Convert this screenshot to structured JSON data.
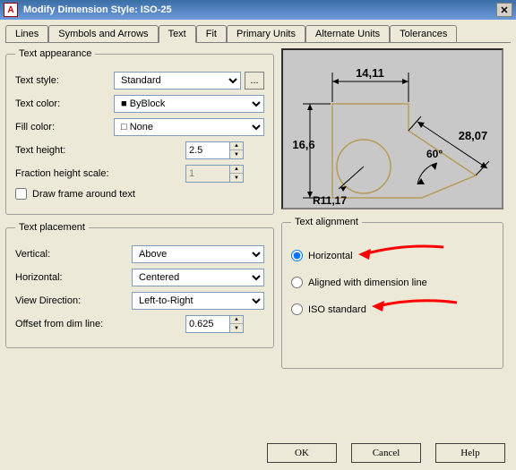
{
  "window": {
    "title": "Modify Dimension Style: ISO-25",
    "app_icon_letter": "A"
  },
  "tabs": [
    "Lines",
    "Symbols and Arrows",
    "Text",
    "Fit",
    "Primary Units",
    "Alternate Units",
    "Tolerances"
  ],
  "active_tab": "Text",
  "text_appearance": {
    "legend": "Text appearance",
    "style_label": "Text style:",
    "style_value": "Standard",
    "color_label": "Text color:",
    "color_value": "ByBlock",
    "fill_label": "Fill color:",
    "fill_value": "None",
    "height_label": "Text height:",
    "height_value": "2.5",
    "fraction_label": "Fraction height scale:",
    "fraction_value": "1",
    "frame_label": "Draw frame around text",
    "frame_checked": false
  },
  "text_placement": {
    "legend": "Text placement",
    "vertical_label": "Vertical:",
    "vertical_value": "Above",
    "horizontal_label": "Horizontal:",
    "horizontal_value": "Centered",
    "viewdir_label": "View Direction:",
    "viewdir_value": "Left-to-Right",
    "offset_label": "Offset from dim line:",
    "offset_value": "0.625"
  },
  "text_alignment": {
    "legend": "Text alignment",
    "horizontal_label": "Horizontal",
    "aligned_label": "Aligned with dimension line",
    "iso_label": "ISO standard",
    "selected": "horizontal"
  },
  "preview": {
    "dim_top": "14,11",
    "dim_left": "16,6",
    "dim_right": "28,07",
    "dim_radius": "R11,17",
    "dim_angle": "60°"
  },
  "buttons": {
    "ok": "OK",
    "cancel": "Cancel",
    "help": "Help",
    "browse": "..."
  }
}
